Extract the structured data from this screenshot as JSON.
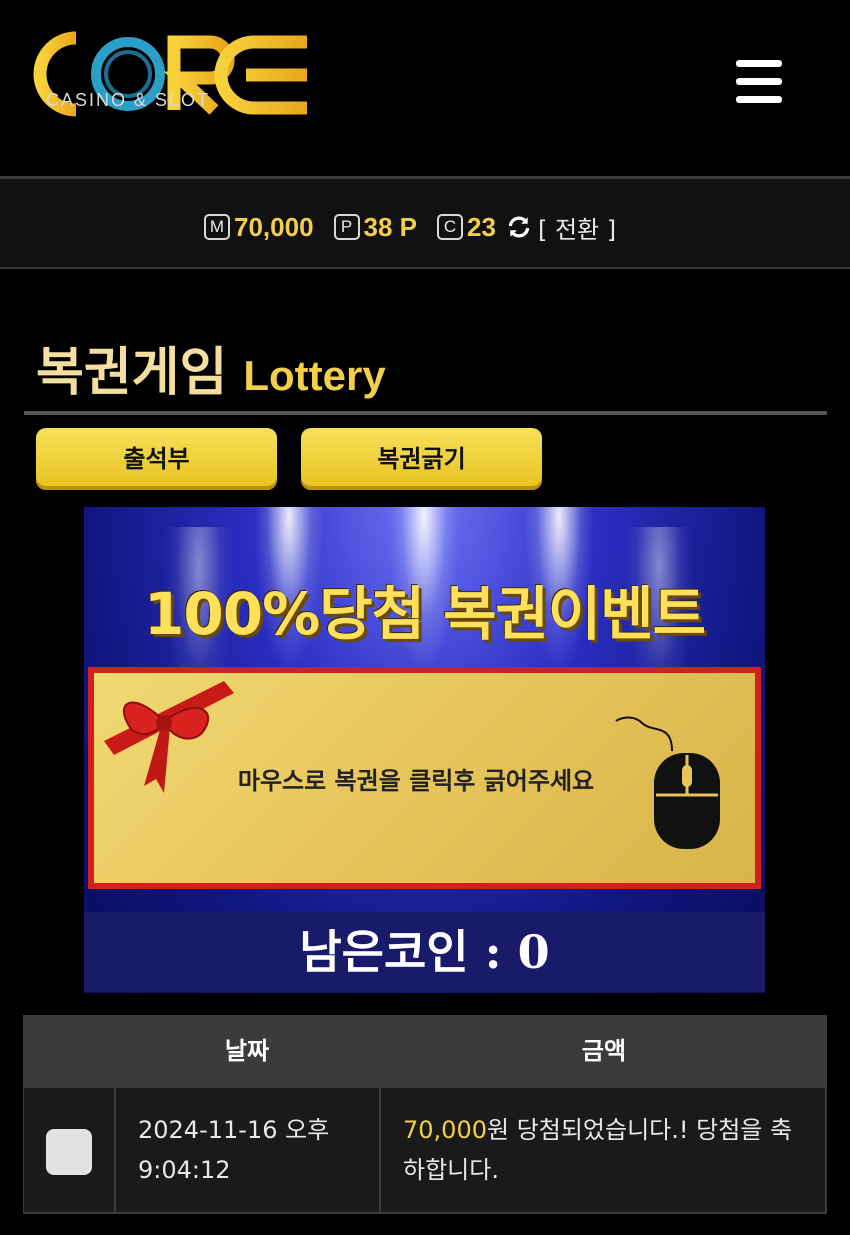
{
  "header": {
    "logo_text": "CORE",
    "logo_subtitle": "CASINO & SLOT",
    "menu_icon": "hamburger-menu-icon"
  },
  "balance": {
    "money_tag": "M",
    "money_value": "70,000",
    "point_tag": "P",
    "point_value": "38 P",
    "coin_tag": "C",
    "coin_value": "23",
    "switch_icon": "refresh-icon",
    "switch_label": "[ 전환 ]"
  },
  "page": {
    "title_ko": "복권게임",
    "title_en": "Lottery"
  },
  "tabs": {
    "attendance_label": "출석부",
    "scratch_label": "복권긁기"
  },
  "banner": {
    "headline": "100%당첨 복권이벤트",
    "instruction": "마우스로 복권을 클릭후 긁어주세요",
    "remaining_coins": "남은코인 : 0",
    "decor_icons": [
      "red-ribbon-icon",
      "computer-mouse-icon"
    ]
  },
  "table": {
    "headers": [
      "날짜",
      "금액"
    ],
    "rows": [
      {
        "date": "2024-11-16 오후 9:04:12",
        "amount": "70,000",
        "message": "원 당첨되었습니다.! 당첨을 축하합니다."
      }
    ]
  },
  "colors": {
    "accent_yellow": "#f2cf4a",
    "background": "#000000",
    "banner_blue": "#191a6a",
    "card_border_red": "#d4201c"
  }
}
